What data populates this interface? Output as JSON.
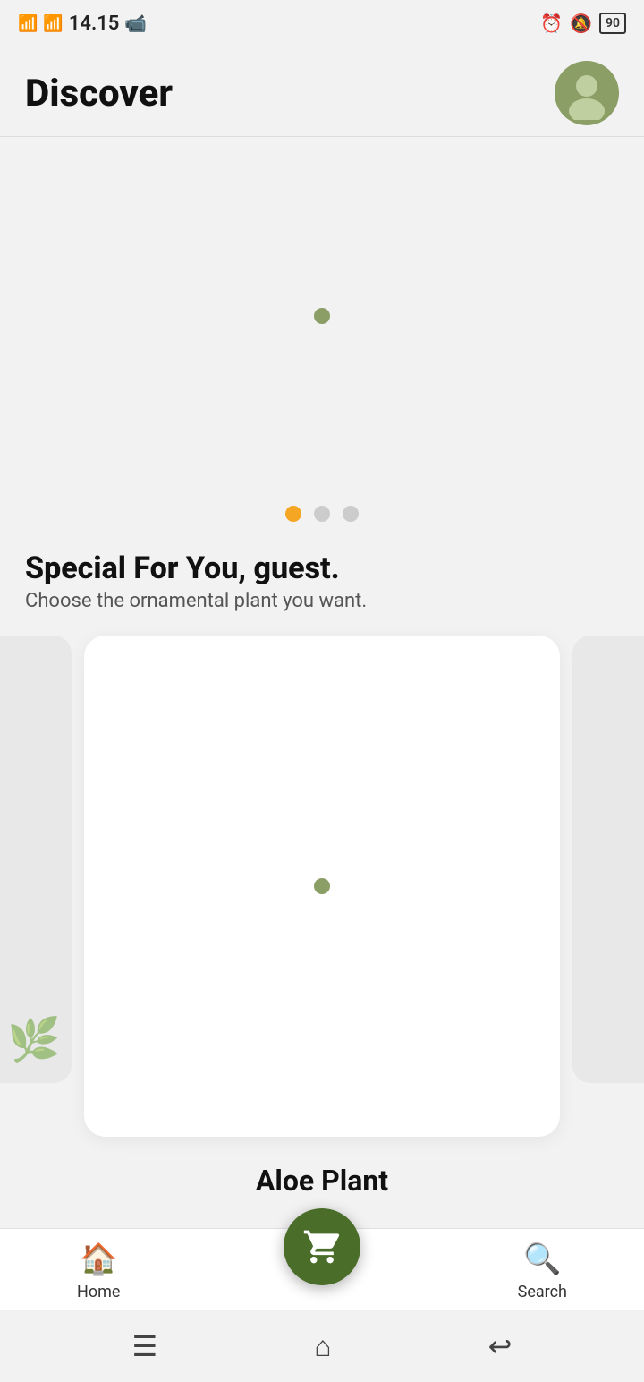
{
  "statusBar": {
    "network1": "4G",
    "network2": "4G",
    "time": "14.15",
    "alarmIcon": "⏰",
    "bellIcon": "🔕",
    "batteryLevel": "90"
  },
  "header": {
    "title": "Discover",
    "avatarAlt": "user avatar"
  },
  "heroSection": {
    "dotColor": "#8a9e65"
  },
  "carouselDots": [
    {
      "active": true
    },
    {
      "active": false
    },
    {
      "active": false
    }
  ],
  "specialSection": {
    "title": "Special For You, guest.",
    "subtitle": "Choose the ornamental plant you want."
  },
  "productSection": {
    "currentProduct": "Aloe Plant"
  },
  "bottomNav": {
    "homeLabel": "Home",
    "searchLabel": "Search",
    "cartAlt": "cart"
  },
  "systemNav": {
    "menuIcon": "☰",
    "homeIcon": "⌂",
    "backIcon": "↩"
  }
}
